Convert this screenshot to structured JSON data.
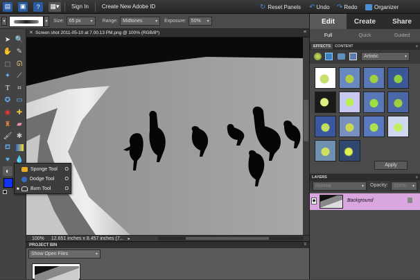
{
  "topbar": {
    "sign_in": "Sign In",
    "create_adobe_id": "Create New Adobe ID",
    "reset_panels": "Reset Panels",
    "undo": "Undo",
    "redo": "Redo",
    "organizer": "Organizer"
  },
  "options": {
    "size_label": "Size:",
    "size_value": "65 px",
    "range_label": "Range:",
    "range_value": "Midtones",
    "exposure_label": "Exposure:",
    "exposure_value": "50%"
  },
  "document": {
    "tab_title": "Screen shot 2011-05-10 at 7.00.13 PM.png @ 100% (RGB/8*)",
    "zoom": "100%",
    "dimensions": "12.651 inches x 8.457 inches (7..."
  },
  "tool_flyout": {
    "items": [
      {
        "label": "Sponge Tool",
        "shortcut": "O"
      },
      {
        "label": "Dodge Tool",
        "shortcut": "O"
      },
      {
        "label": "Burn Tool",
        "shortcut": "O"
      }
    ]
  },
  "project_bin": {
    "title": "PROJECT BIN",
    "dropdown": "Show Open Files"
  },
  "right_panel": {
    "tabs": [
      "Edit",
      "Create",
      "Share"
    ],
    "subtabs": [
      "Full",
      "Quick",
      "Guided"
    ],
    "effects_tab": "EFFECTS",
    "content_tab": "CONTENT",
    "filter_dropdown": "Artistic",
    "apply_button": "Apply",
    "layers_title": "LAYERS",
    "blend_mode": "Normal",
    "opacity_label": "Opacity:",
    "opacity_value": "100%",
    "layer_name": "Background"
  },
  "colors": {
    "accent_blue": "#4a8fd8",
    "layer_highlight": "#d9a6e0",
    "foreground_swatch": "#1133ee"
  }
}
